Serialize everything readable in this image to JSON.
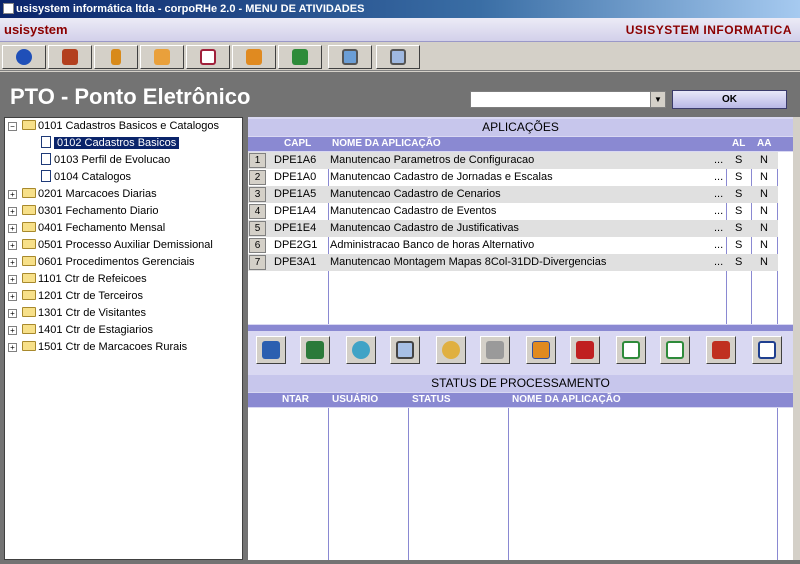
{
  "window": {
    "title": "usisystem informática ltda - corpoRHe 2.0 - MENU DE ATIVIDADES"
  },
  "appbar": {
    "left": "usisystem",
    "right": "USISYSTEM INFORMATICA"
  },
  "toolbar": {
    "buttons": [
      "back-icon",
      "users-icon",
      "person-icon",
      "document-x-icon",
      "report-icon",
      "book-icon",
      "green-book-icon",
      "monitor-icon",
      "monitor-settings-icon"
    ]
  },
  "page": {
    "title": "PTO - Ponto Eletrônico",
    "combo_value": "",
    "ok_label": "OK"
  },
  "tree": {
    "root": "0101 Cadastros Basicos e Catalogos",
    "children": [
      "0102 Cadastros Basicos",
      "0103 Perfil de Evolucao",
      "0104 Catalogos"
    ],
    "groups": [
      "0201 Marcacoes Diarias",
      "0301 Fechamento Diario",
      "0401 Fechamento Mensal",
      "0501 Processo Auxiliar Demissional",
      "0601 Procedimentos Gerenciais",
      "1101 Ctr de Refeicoes",
      "1201 Ctr de Terceiros",
      "1301 Ctr de Visitantes",
      "1401 Ctr de Estagiarios",
      "1501 Ctr de Marcacoes Rurais"
    ]
  },
  "apps": {
    "title": "APLICAÇÕES",
    "headers": {
      "capl": "CAPL",
      "nome": "NOME DA APLICAÇÃO",
      "al": "AL",
      "aa": "AA"
    },
    "rows": [
      {
        "n": "1",
        "capl": "DPE1A6",
        "nome": "Manutencao Parametros de Configuracao",
        "more": "...",
        "al": "S",
        "aa": "N"
      },
      {
        "n": "2",
        "capl": "DPE1A0",
        "nome": "Manutencao Cadastro de Jornadas e Escalas",
        "more": "...",
        "al": "S",
        "aa": "N"
      },
      {
        "n": "3",
        "capl": "DPE1A5",
        "nome": "Manutencao Cadastro de Cenarios",
        "more": "...",
        "al": "S",
        "aa": "N"
      },
      {
        "n": "4",
        "capl": "DPE1A4",
        "nome": "Manutencao Cadastro de Eventos",
        "more": "...",
        "al": "S",
        "aa": "N"
      },
      {
        "n": "5",
        "capl": "DPE1E4",
        "nome": "Manutencao Cadastro de Justificativas",
        "more": "...",
        "al": "S",
        "aa": "N"
      },
      {
        "n": "6",
        "capl": "DPE2G1",
        "nome": "Administracao Banco de horas Alternativo",
        "more": "...",
        "al": "S",
        "aa": "N"
      },
      {
        "n": "7",
        "capl": "DPE3A1",
        "nome": "Manutencao Montagem Mapas 8Col-31DD-Divergencias",
        "more": "...",
        "al": "S",
        "aa": "N"
      }
    ]
  },
  "actions": [
    "tree-icon",
    "tree-add-icon",
    "refresh-icon",
    "monitor-icon",
    "clock-icon",
    "printer-icon",
    "upload-icon",
    "erase-icon",
    "export-icon",
    "import-icon",
    "send-icon",
    "word-icon"
  ],
  "status": {
    "title": "STATUS DE PROCESSAMENTO",
    "headers": {
      "ntar": "NTAR",
      "usuario": "USUÁRIO",
      "status": "STATUS",
      "nome": "NOME DA APLICAÇÃO"
    }
  },
  "colors": {
    "accent": "#0a246a",
    "panel": "#d9d8f2",
    "header": "#8a89d2",
    "brand": "#8b0000"
  }
}
